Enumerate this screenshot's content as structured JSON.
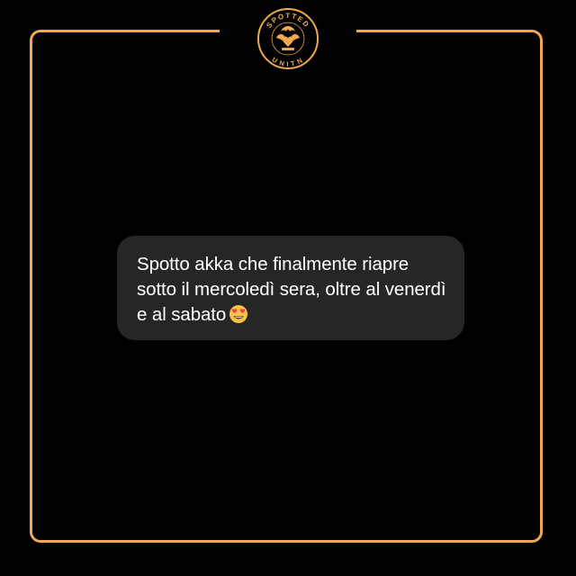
{
  "brand": {
    "logo_top_text": "SPOTTED",
    "logo_bottom_text": "UNITN",
    "accent_color": "#f0a94c",
    "background_color": "#000000"
  },
  "post": {
    "message": "Spotto akka che finalmente riapre sotto il mercoledì sera, oltre al venerdì e al sabato",
    "emoji": "heart-eyes-emoji",
    "bubble_color": "#262626",
    "text_color": "#ffffff"
  }
}
